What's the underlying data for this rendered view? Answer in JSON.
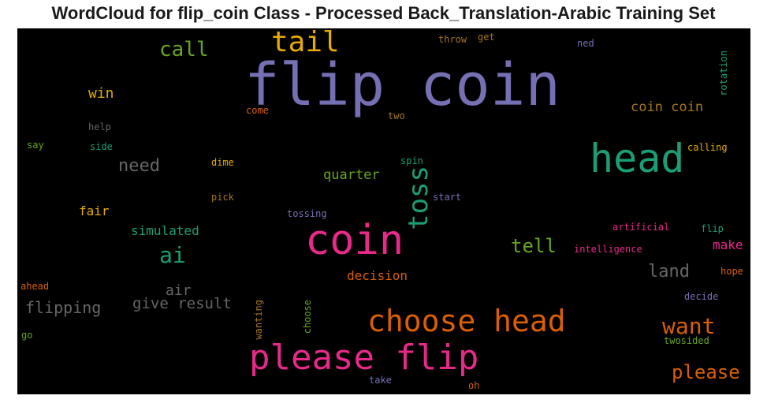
{
  "chart_data": {
    "type": "wordcloud",
    "title": "WordCloud for flip_coin Class - Processed Back_Translation-Arabic Training Set",
    "background": "#000000",
    "colors": {
      "purple": "#7570b3",
      "green": "#1b9e77",
      "lime": "#66a61e",
      "pink": "#e7298a",
      "orange": "#d95f02",
      "gold": "#e6ab02",
      "brown": "#a6761d",
      "gray": "#666666"
    },
    "words": [
      {
        "text": "flip coin",
        "color": "purple"
      },
      {
        "text": "coin",
        "color": "pink"
      },
      {
        "text": "please flip",
        "color": "pink"
      },
      {
        "text": "head",
        "color": "green"
      },
      {
        "text": "choose head",
        "color": "orange"
      },
      {
        "text": "tail",
        "color": "gold"
      },
      {
        "text": "toss",
        "color": "green"
      },
      {
        "text": "want",
        "color": "orange"
      },
      {
        "text": "ai",
        "color": "green"
      },
      {
        "text": "call",
        "color": "lime"
      },
      {
        "text": "please",
        "color": "orange"
      },
      {
        "text": "need",
        "color": "gray"
      },
      {
        "text": "tell",
        "color": "lime"
      },
      {
        "text": "land",
        "color": "gray"
      },
      {
        "text": "flipping",
        "color": "gray"
      },
      {
        "text": "give result",
        "color": "gray"
      },
      {
        "text": "coin coin",
        "color": "brown"
      },
      {
        "text": "win",
        "color": "gold"
      },
      {
        "text": "quarter",
        "color": "lime"
      },
      {
        "text": "decision",
        "color": "orange"
      },
      {
        "text": "simulated",
        "color": "green"
      },
      {
        "text": "air",
        "color": "gray"
      },
      {
        "text": "fair",
        "color": "gold"
      },
      {
        "text": "make",
        "color": "pink"
      },
      {
        "text": "calling",
        "color": "gold"
      },
      {
        "text": "help",
        "color": "gray"
      },
      {
        "text": "side",
        "color": "green"
      },
      {
        "text": "say",
        "color": "lime"
      },
      {
        "text": "dime",
        "color": "gold"
      },
      {
        "text": "pick",
        "color": "brown"
      },
      {
        "text": "spin",
        "color": "green"
      },
      {
        "text": "start",
        "color": "purple"
      },
      {
        "text": "tossing",
        "color": "purple"
      },
      {
        "text": "two",
        "color": "brown"
      },
      {
        "text": "come",
        "color": "orange"
      },
      {
        "text": "throw",
        "color": "brown"
      },
      {
        "text": "get",
        "color": "brown"
      },
      {
        "text": "ned",
        "color": "purple"
      },
      {
        "text": "rotation",
        "color": "green"
      },
      {
        "text": "artificial",
        "color": "pink"
      },
      {
        "text": "flip",
        "color": "green"
      },
      {
        "text": "intelligence",
        "color": "pink"
      },
      {
        "text": "hope",
        "color": "orange"
      },
      {
        "text": "decide",
        "color": "purple"
      },
      {
        "text": "twosided",
        "color": "lime"
      },
      {
        "text": "ahead",
        "color": "orange"
      },
      {
        "text": "go",
        "color": "lime"
      },
      {
        "text": "wanting",
        "color": "brown"
      },
      {
        "text": "choose",
        "color": "lime"
      },
      {
        "text": "take",
        "color": "purple"
      },
      {
        "text": "oh",
        "color": "orange"
      }
    ]
  }
}
